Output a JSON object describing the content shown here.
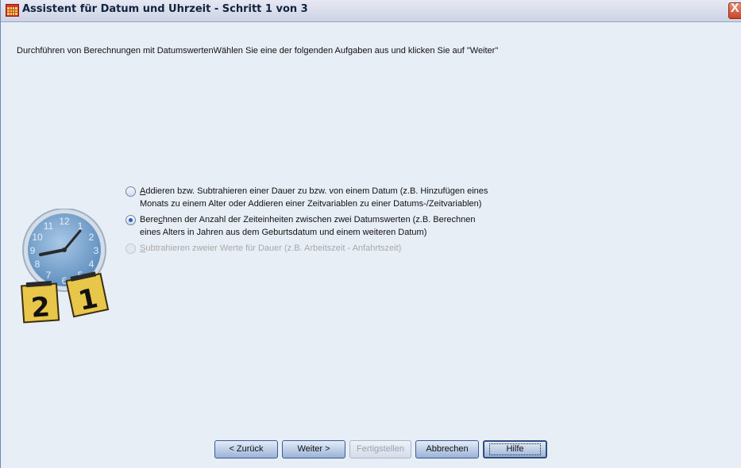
{
  "window": {
    "title": "Assistent für Datum und Uhrzeit - Schritt 1 von 3",
    "close_label": "X"
  },
  "instruction": "Durchführen von Berechnungen mit DatumswertenWählen Sie eine der folgenden Aufgaben aus und klicken Sie auf \"Weiter\"",
  "options": [
    {
      "mnemonic": "A",
      "line1_rest": "ddieren bzw. Subtrahieren einer Dauer zu bzw. von einem Datum (z.B. Hinzufügen eines",
      "line2": "Monats zu einem Alter oder Addieren einer Zeitvariablen zu einer Datums-/Zeitvariablen)",
      "checked": false,
      "enabled": true
    },
    {
      "prefix": "Bere",
      "mnemonic": "c",
      "line1_rest": "hnen der Anzahl der Zeiteinheiten zwischen zwei Datumswerten (z.B. Berechnen",
      "line2": "eines Alters in Jahren aus dem Geburtsdatum und einem weiteren Datum)",
      "checked": true,
      "enabled": true
    },
    {
      "mnemonic": "S",
      "line1_rest": "ubtrahieren zweier Werte für Dauer (z.B. Arbeitszeit - Anfahrtszeit)",
      "checked": false,
      "enabled": false
    }
  ],
  "illustration": {
    "icon": "clock-calendar-icon",
    "clock_numbers": [
      "12",
      "1",
      "2",
      "3",
      "4",
      "5",
      "6",
      "7",
      "8",
      "9",
      "10",
      "11"
    ],
    "calendar_pages": [
      "2",
      "1"
    ]
  },
  "buttons": {
    "back": "< Zurück",
    "next": "Weiter >",
    "finish": "Fertigstellen",
    "cancel": "Abbrechen",
    "help": "Hilfe"
  },
  "colors": {
    "accent": "#2a5fc4",
    "clock_face": "#6e9cc8",
    "calendar": "#e8c64a"
  }
}
